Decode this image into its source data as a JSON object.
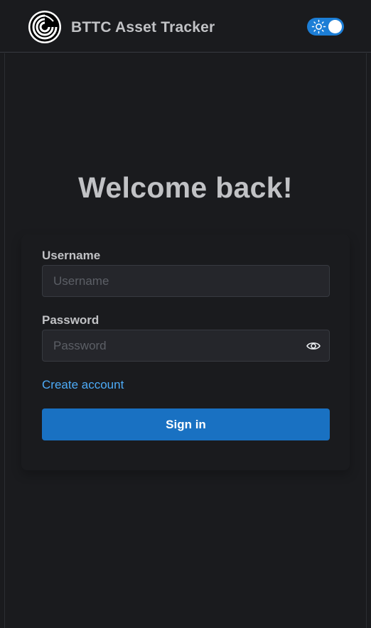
{
  "header": {
    "title": "BTTC Asset Tracker",
    "logo_icon": "bttc-logo-icon",
    "theme_toggle": {
      "icon": "sun-icon",
      "state": "on",
      "accent": "#1c7ed6"
    }
  },
  "main": {
    "heading": "Welcome back!",
    "form": {
      "username": {
        "label": "Username",
        "placeholder": "Username",
        "value": ""
      },
      "password": {
        "label": "Password",
        "placeholder": "Password",
        "value": "",
        "toggle_icon": "eye-icon"
      },
      "create_account_link": "Create account",
      "submit_label": "Sign in"
    }
  },
  "colors": {
    "background": "#1a1b1e",
    "input_background": "#25262b",
    "text": "#c1c2c5",
    "link": "#4dabf7",
    "primary_button": "#1971c2"
  }
}
